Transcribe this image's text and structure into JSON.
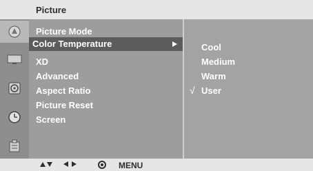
{
  "menu": {
    "title": "Picture",
    "items": [
      {
        "label": "Picture Mode"
      },
      {
        "label": "Color Temperature"
      },
      {
        "label": "XD"
      },
      {
        "label": "Advanced"
      },
      {
        "label": "Aspect Ratio"
      },
      {
        "label": "Picture Reset"
      },
      {
        "label": "Screen"
      }
    ],
    "selected_index": 1
  },
  "submenu": {
    "items": [
      {
        "label": "Cool"
      },
      {
        "label": "Medium"
      },
      {
        "label": "Warm"
      },
      {
        "label": "User",
        "checked": true
      }
    ],
    "check_mark": "√"
  },
  "footer": {
    "menu_label": "MENU"
  },
  "icons": [
    "picture-icon",
    "display-icon",
    "audio-icon",
    "clock-icon",
    "option-icon"
  ],
  "colors": {
    "titlebar": "#e6e6e6",
    "menu_bg": "#9d9d9d",
    "selected_bg": "#5c5c5c",
    "text": "#ffffff"
  }
}
